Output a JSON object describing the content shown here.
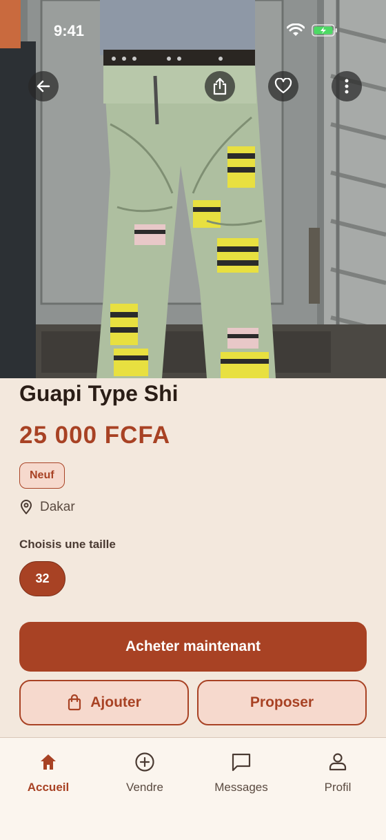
{
  "status_bar": {
    "time": "9:41"
  },
  "hero": {
    "icons": [
      "back-arrow-icon",
      "share-icon",
      "heart-icon",
      "more-vertical-icon"
    ]
  },
  "product": {
    "title": "Guapi Type Shi",
    "price": "25 000 FCFA",
    "condition": "Neuf",
    "location": "Dakar",
    "size_label": "Choisis une taille",
    "sizes": [
      "32"
    ],
    "selected_size": "32"
  },
  "actions": {
    "buy_label": "Acheter maintenant",
    "add_label": "Ajouter",
    "offer_label": "Proposer"
  },
  "bottom_nav": [
    {
      "label": "Accueil",
      "icon": "home-icon",
      "active": true
    },
    {
      "label": "Vendre",
      "icon": "plus-circle-icon",
      "active": false
    },
    {
      "label": "Messages",
      "icon": "chat-icon",
      "active": false
    },
    {
      "label": "Profil",
      "icon": "user-icon",
      "active": false
    }
  ],
  "colors": {
    "accent": "#a84224",
    "accent_light": "#f6d9cd",
    "background": "#f3e8dd",
    "nav_background": "#fbf5ee"
  }
}
